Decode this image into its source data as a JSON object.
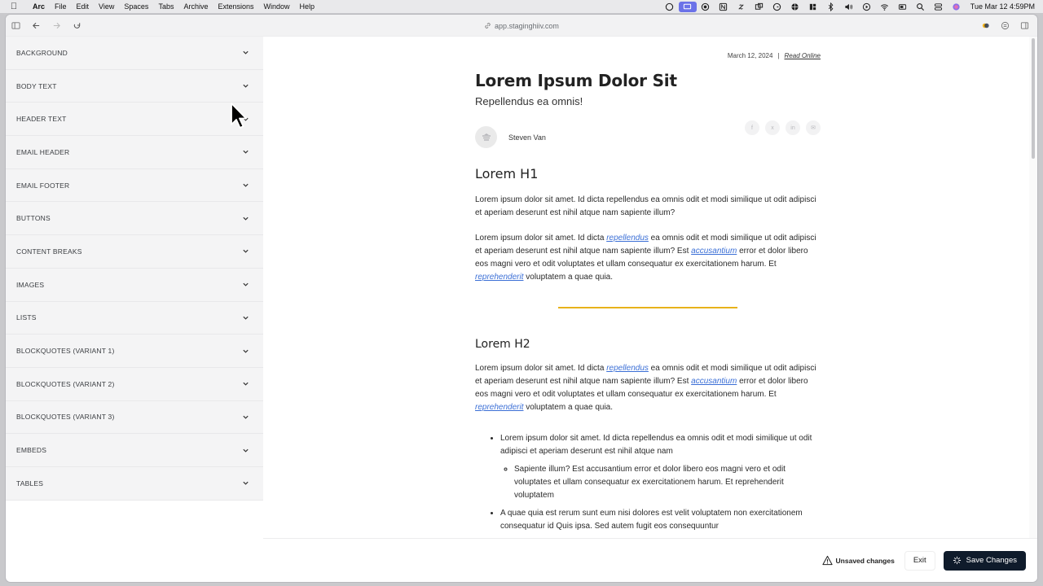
{
  "menubar": {
    "items": [
      "Arc",
      "File",
      "Edit",
      "View",
      "Spaces",
      "Tabs",
      "Archive",
      "Extensions",
      "Window",
      "Help"
    ],
    "clock": "Tue Mar 12  4:59PM"
  },
  "browser": {
    "url": "app.staginghiiv.com"
  },
  "sidebar": {
    "items": [
      {
        "label": "BACKGROUND"
      },
      {
        "label": "BODY TEXT"
      },
      {
        "label": "HEADER TEXT"
      },
      {
        "label": "EMAIL HEADER"
      },
      {
        "label": "EMAIL FOOTER"
      },
      {
        "label": "BUTTONS"
      },
      {
        "label": "CONTENT BREAKS"
      },
      {
        "label": "IMAGES"
      },
      {
        "label": "LISTS"
      },
      {
        "label": "BLOCKQUOTES (VARIANT 1)"
      },
      {
        "label": "BLOCKQUOTES (VARIANT 2)"
      },
      {
        "label": "BLOCKQUOTES (VARIANT 3)"
      },
      {
        "label": "EMBEDS"
      },
      {
        "label": "TABLES"
      }
    ]
  },
  "email": {
    "date": "March 12, 2024",
    "separator": "|",
    "read_online": "Read Online",
    "title": "Lorem Ipsum Dolor Sit",
    "subtitle": "Repellendus ea omnis!",
    "author": "Steven Van",
    "socials": [
      "f",
      "x",
      "in",
      "✉"
    ],
    "h1": "Lorem H1",
    "p1": "Lorem ipsum dolor sit amet. Id dicta repellendus ea omnis odit et modi similique ut odit adipisci et aperiam deserunt est nihil atque nam sapiente illum?",
    "p2": {
      "a": "Lorem ipsum dolor sit amet. Id dicta ",
      "link1": "repellendus",
      "b": " ea omnis odit et modi similique ut odit adipisci et aperiam deserunt est nihil atque nam sapiente illum? Est ",
      "link2": "accusantium",
      "c": " error et dolor libero eos magni vero et odit voluptates et ullam consequatur ex exercitationem harum. Et ",
      "link3": "reprehenderit",
      "d": " voluptatem a quae quia."
    },
    "h2": "Lorem H2",
    "p3": {
      "a": "Lorem ipsum dolor sit amet. Id dicta ",
      "link1": "repellendus",
      "b": " ea omnis odit et modi similique ut odit adipisci et aperiam deserunt est nihil atque nam sapiente illum? Est ",
      "link2": "accusantium",
      "c": " error et dolor libero eos magni vero et odit voluptates et ullam consequatur ex exercitationem harum. Et ",
      "link3": "reprehenderit",
      "d": " voluptatem a quae quia."
    },
    "list": {
      "item1": "Lorem ipsum dolor sit amet. Id dicta repellendus ea omnis odit et modi similique ut odit adipisci et aperiam deserunt est nihil atque nam",
      "sub1": "Sapiente illum? Est accusantium error et dolor libero eos magni vero et odit voluptates et ullam consequatur ex exercitationem harum. Et reprehenderit voluptatem",
      "item2": "A quae quia est rerum sunt eum nisi dolores est velit voluptatem non exercitationem consequatur id Quis ipsa. Sed autem fugit eos consequuntur"
    }
  },
  "actions": {
    "unsaved": "Unsaved changes",
    "exit": "Exit",
    "save": "Save Changes"
  },
  "colors": {
    "divider": "#e8b21a",
    "link": "#3b6fd6",
    "save_bg": "#0f1b2b"
  }
}
